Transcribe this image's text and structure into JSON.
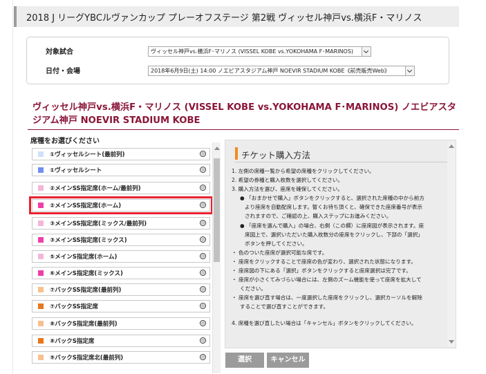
{
  "header": {
    "title": "2018 J リーグYBCルヴァンカップ プレーオフステージ 第2戦 ヴィッセル神戸vs.横浜F・マリノス"
  },
  "selection": {
    "match_label": "対象試合",
    "match_value": "ヴィッセル神戸vs.横浜F･マリノス (VISSEL KOBE vs.YOKOHAMA F･MARINOS)",
    "date_label": "日付・会場",
    "date_value": "2018年6月9日(土) 14:00 ノエビアスタジアム神戸 NOEVIR STADIUM KOBE《前売販売Web》"
  },
  "event": {
    "title": "ヴィッセル神戸vs.横浜F・マリノス (VISSEL KOBE vs.YOKOHAMA F･MARINOS) ノエビアスタジアム神戸 NOEVIR STADIUM KOBE"
  },
  "seats": {
    "caption": "席種をお選びください",
    "info_glyph": "◎",
    "items": [
      {
        "label": "①ヴィッセルシート(最前列)",
        "color": "#cfe1f9"
      },
      {
        "label": "①ヴィッセルシート",
        "color": "#6f8ff0"
      },
      {
        "label": "②メインSS指定席(ホーム/最前列)",
        "color": "#f3b7d9"
      },
      {
        "label": "②メインSS指定席(ホーム)",
        "color": "#ee3fa9"
      },
      {
        "label": "③メインSS指定席(ミックス/最前列)",
        "color": "#f3b7d9"
      },
      {
        "label": "③メインSS指定席(ミックス)",
        "color": "#ee3fa9"
      },
      {
        "label": "⑤メインS指定席(ホーム)",
        "color": "#f3b7d9"
      },
      {
        "label": "⑥メインS指定席(ミックス)",
        "color": "#ee3fa9"
      },
      {
        "label": "⑦バックSS指定席(最前列)",
        "color": "#f7c08f"
      },
      {
        "label": "⑦バックSS指定席",
        "color": "#e8771c"
      },
      {
        "label": "⑧バックS指定席(最前列)",
        "color": "#f7c08f"
      },
      {
        "label": "⑧バックS指定席",
        "color": "#e8771c"
      },
      {
        "label": "⑨バックS指定席北(最前列)",
        "color": "#f7c08f"
      }
    ]
  },
  "how_to": {
    "title": "チケット購入方法",
    "lines": [
      "1. 左側の席種一覧から希望の席種をクリックしてください。",
      "2. 希望の券種と購入枚数を選択してください。",
      "3. 購入方法を選び、座席を確保してください。",
      "●  「おまかせで購入」ボタンをクリックすると、選択された席種の中から前方",
      "より座席を自動配席します。暫くお待ち頂くと、確保できた座席番号が表示",
      "されますので、ご確認の上、購入ステップにお進みください。",
      "●  「座席を選んで購入」の場合、右側（この欄）に座席図が表示されます。座",
      "席図上で、選択いただいた購入枚数分の座席をクリックし、下部の「選択」",
      "ボタンを押してください。",
      "・ 色のついた座席が選択可能な席です。",
      "・ 座席をクリックすることで座席の色が変わり、選択された状態になります。",
      "・ 座席図の下にある「選択」ボタンをクリックすると座席選択は完了です。",
      "・ 座席が小さくてみづらい場合には、左側のズーム機能を使って座席を拡大して",
      "ください。",
      "・ 座席を選び直す場合は、一度選択した座席をクリックし、選択カーソルを解除",
      "することで選び直すことができます。",
      "",
      "4. 席種を選び直したい場合は「キャンセル」ボタンをクリックしてください。"
    ]
  },
  "buttons": {
    "select": "選択",
    "cancel": "キャンセル"
  },
  "colors": {
    "accent": "#8a1538",
    "highlight": "#e8212e",
    "title_marker": "#f08c1e"
  }
}
